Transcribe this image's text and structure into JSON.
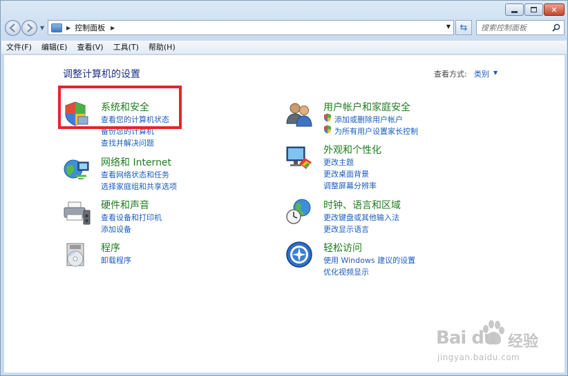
{
  "breadcrumb": {
    "location": "控制面板"
  },
  "search": {
    "placeholder": "搜索控制面板"
  },
  "menu": [
    "文件(F)",
    "编辑(E)",
    "查看(V)",
    "工具(T)",
    "帮助(H)"
  ],
  "page": {
    "title": "调整计算机的设置",
    "view_by_label": "查看方式:",
    "view_by_value": "类别"
  },
  "categories_left": [
    {
      "title": "系统和安全",
      "icon": "shield-icon",
      "links": [
        "查看您的计算机状态",
        "备份您的计算机",
        "查找并解决问题"
      ]
    },
    {
      "title": "网络和 Internet",
      "icon": "network-globe-icon",
      "links": [
        "查看网络状态和任务",
        "选择家庭组和共享选项"
      ]
    },
    {
      "title": "硬件和声音",
      "icon": "printer-icon",
      "links": [
        "查看设备和打印机",
        "添加设备"
      ]
    },
    {
      "title": "程序",
      "icon": "program-disc-icon",
      "links": [
        "卸载程序"
      ]
    }
  ],
  "categories_right": [
    {
      "title": "用户帐户和家庭安全",
      "icon": "users-icon",
      "links": [
        "添加或删除用户帐户",
        "为所有用户设置家长控制"
      ]
    },
    {
      "title": "外观和个性化",
      "icon": "monitor-paint-icon",
      "links": [
        "更改主题",
        "更改桌面背景",
        "调整屏幕分辨率"
      ]
    },
    {
      "title": "时钟、语言和区域",
      "icon": "clock-globe-icon",
      "links": [
        "更改键盘或其他输入法",
        "更改显示语言"
      ]
    },
    {
      "title": "轻松访问",
      "icon": "ease-of-access-icon",
      "links": [
        "使用 Windows 建议的设置",
        "优化视频显示"
      ]
    }
  ],
  "watermark": {
    "brand": "Bai du",
    "suffix": "经验",
    "url": "jingyan.baidu.com"
  },
  "colors": {
    "highlight": "#e8232b",
    "link": "#1a5dbf",
    "category": "#1e7c1e",
    "title": "#1e3287"
  }
}
